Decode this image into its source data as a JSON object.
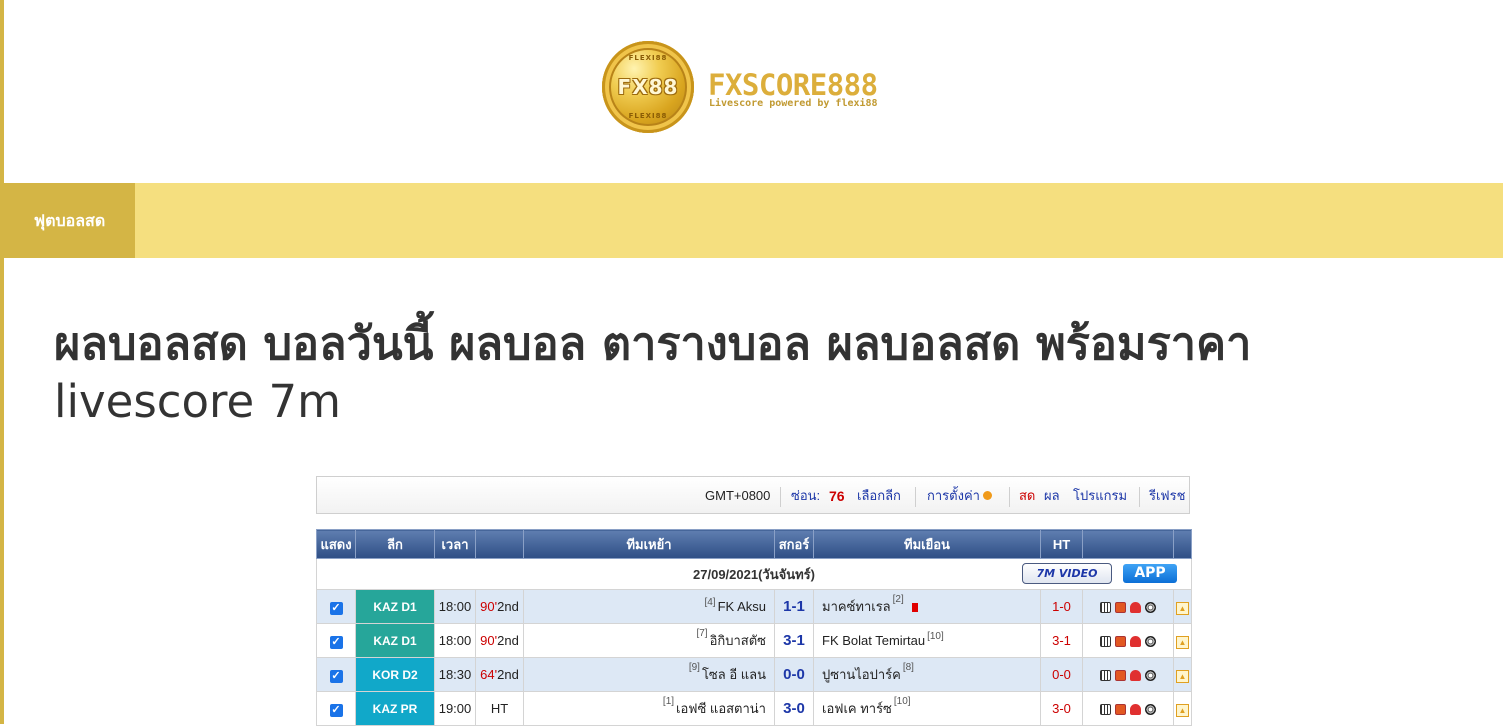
{
  "header": {
    "logo_coin_text": "FX88",
    "logo_ring_top": "FLEXI88",
    "logo_ring_bottom": "FLEXI88",
    "brand_name": "FXSCORE888",
    "brand_tagline": "Livescore powered by flexi88"
  },
  "nav": {
    "items": [
      {
        "label": "ฟุตบอลสด"
      }
    ]
  },
  "page": {
    "title_thai": "ผลบอลสด บอลวันนี้ ผลบอล ตารางบอล ผลบอลสด พร้อมราคา",
    "title_en": "livescore 7m"
  },
  "toolbar": {
    "timezone": "GMT+0800",
    "hide_label": "ซ่อน:",
    "hide_count": "76",
    "choose_league": "เลือกลีก",
    "settings": "การตั้งค่า",
    "live": "สด",
    "results": "ผล",
    "program": "โปรแกรม",
    "refresh": "รีเฟรช"
  },
  "table": {
    "headers": [
      "แสดง",
      "ลีก",
      "เวลา",
      "",
      "ทีมเหย้า",
      "สกอร์",
      "ทีมเยือน",
      "HT",
      ""
    ],
    "date_label": "27/09/2021(วันจันทร์)",
    "video_label": "7M VIDEO",
    "app_label": "APP",
    "rows": [
      {
        "checked": "✓",
        "league": "KAZ D1",
        "league_color": "#26a69a",
        "time": "18:00",
        "minute": "90'",
        "period": "2nd",
        "home_rank": "[4]",
        "home": "FK Aksu",
        "score": "1-1",
        "away": "มาคซ์ทาเรล",
        "away_rank": "[2]",
        "red_card": true,
        "ht": "1-0"
      },
      {
        "checked": "✓",
        "league": "KAZ D1",
        "league_color": "#26a69a",
        "time": "18:00",
        "minute": "90'",
        "period": "2nd",
        "home_rank": "[7]",
        "home": "อิกิบาสตัซ",
        "score": "3-1",
        "away": "FK Bolat Temirtau",
        "away_rank": "[10]",
        "red_card": false,
        "ht": "3-1"
      },
      {
        "checked": "✓",
        "league": "KOR D2",
        "league_color": "#11a8c9",
        "time": "18:30",
        "minute": "64'",
        "period": "2nd",
        "home_rank": "[9]",
        "home": "โซล อี แลน",
        "score": "0-0",
        "away": "ปูซานไอปาร์ค",
        "away_rank": "[8]",
        "red_card": false,
        "ht": "0-0"
      },
      {
        "checked": "✓",
        "league": "KAZ PR",
        "league_color": "#11a8c9",
        "time": "19:00",
        "minute": "",
        "period": "HT",
        "home_rank": "[1]",
        "home": "เอฟซี แอสตาน่า",
        "score": "3-0",
        "away": "เอฟเค ทาร์ซ",
        "away_rank": "[10]",
        "red_card": false,
        "ht": "3-0"
      }
    ],
    "row_icons": [
      "stats-icon",
      "trend-icon",
      "player-icon",
      "ball-icon"
    ],
    "expand_icon": "▲"
  }
}
